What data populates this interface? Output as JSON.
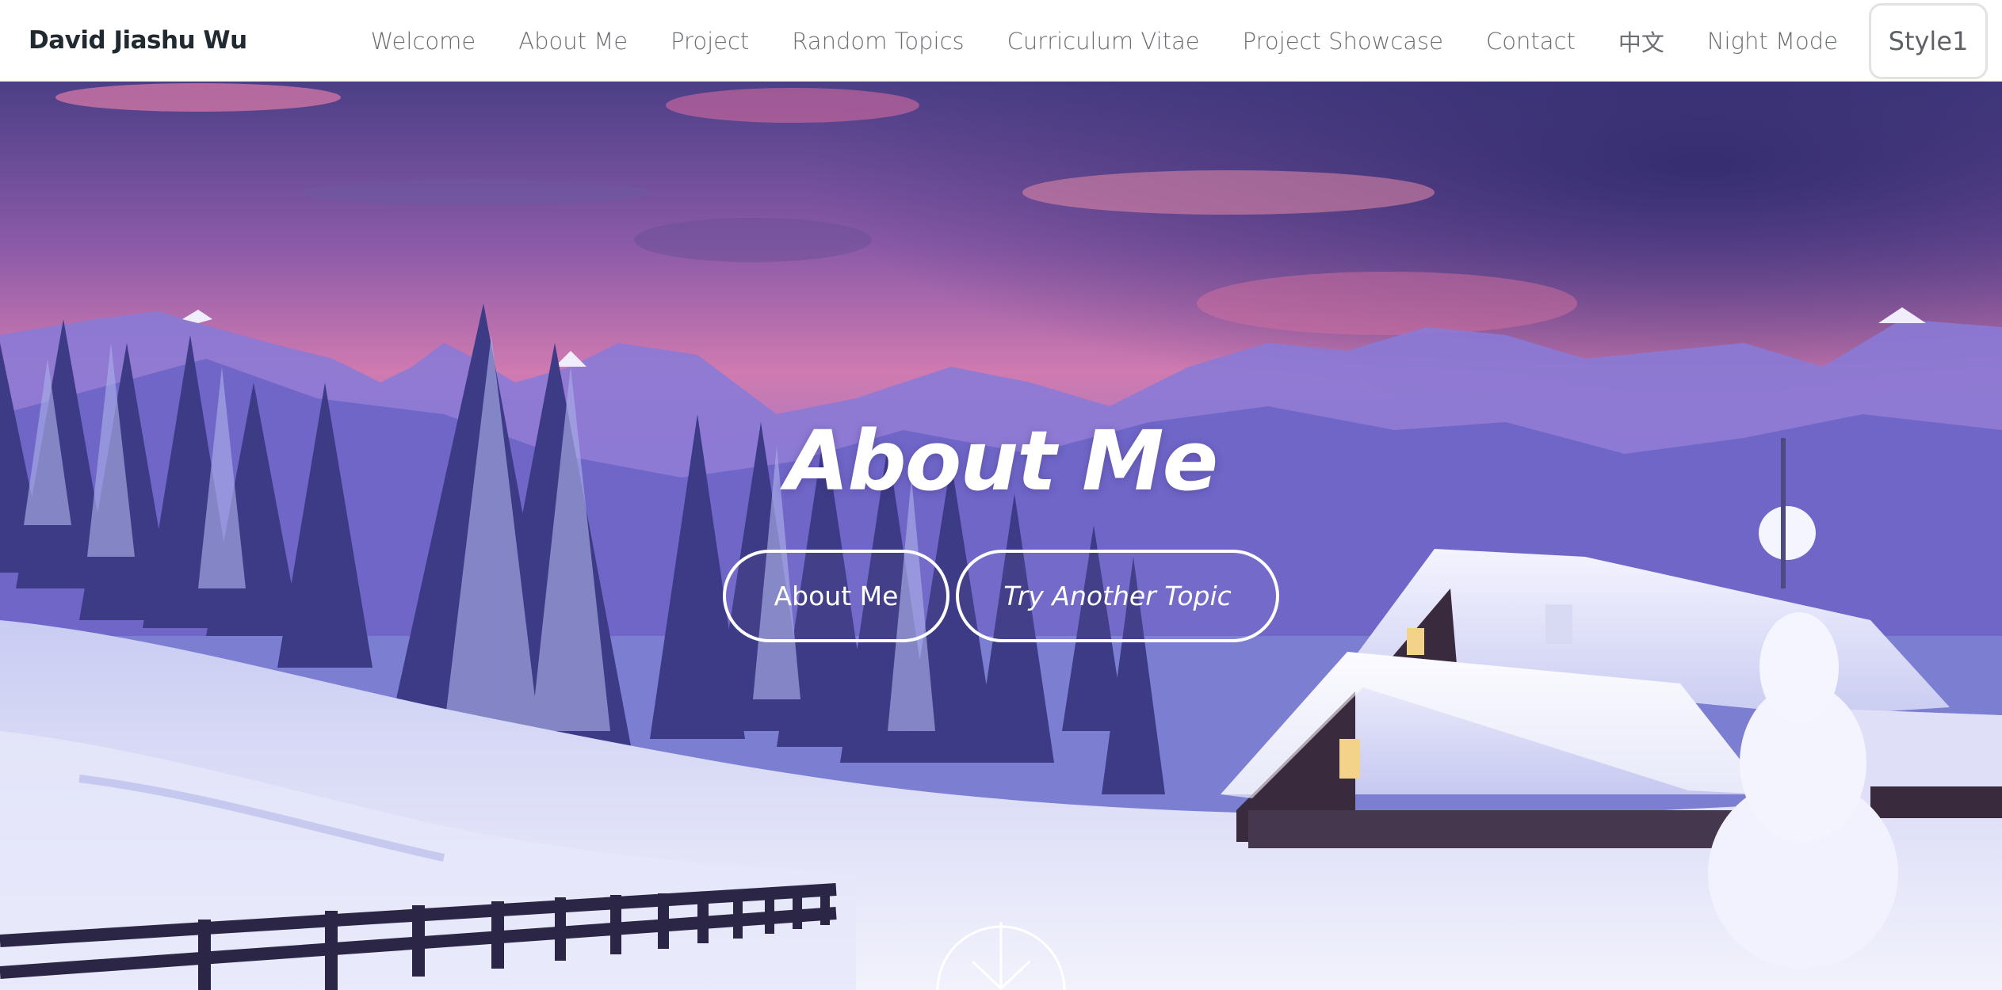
{
  "header": {
    "brand": "David Jiashu Wu",
    "nav": [
      {
        "label": "Welcome"
      },
      {
        "label": "About Me"
      },
      {
        "label": "Project"
      },
      {
        "label": "Random Topics"
      },
      {
        "label": "Curriculum Vitae"
      },
      {
        "label": "Project Showcase"
      },
      {
        "label": "Contact"
      },
      {
        "label": "中文"
      },
      {
        "label": "Night Mode"
      }
    ],
    "style_button": "Style1"
  },
  "hero": {
    "title": "About Me",
    "primary_button": "About Me",
    "secondary_button": "Try Another Topic",
    "scroll_icon": "arrow-down-circle-icon"
  },
  "colors": {
    "navbar_bg": "#ffffff",
    "brand_text": "#222a31",
    "nav_text": "#6b6e72",
    "hero_text": "#ffffff"
  }
}
